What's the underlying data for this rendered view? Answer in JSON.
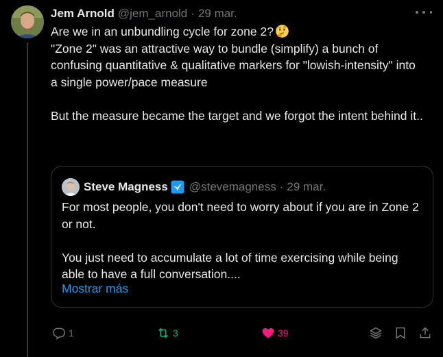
{
  "tweet": {
    "author_name": "Jem Arnold",
    "author_handle": "@jem_arnold",
    "separator": "·",
    "date": "29 mar.",
    "text_line1": "Are we in an unbundling cycle for zone 2?",
    "text_rest": "\n\"Zone 2\" was an attractive way to bundle (simplify) a bunch of confusing quantitative & qualitative markers for \"lowish-intensity\" into a single power/pace measure\n\nBut the measure became the target and we forgot the intent behind it..",
    "emoji": "thinking-face-emoji"
  },
  "quote": {
    "author_name": "Steve Magness",
    "author_handle": "@stevemagness",
    "separator": "·",
    "date": "29 mar.",
    "verified": true,
    "text": "For most people, you don't need to worry about if you are in Zone 2 or not.\n\nYou just need to accumulate a lot of time exercising while being able to have a full conversation....",
    "show_more": "Mostrar más"
  },
  "actions": {
    "replies": "1",
    "retweets": "3",
    "likes": "39"
  },
  "colors": {
    "background": "#000000",
    "text": "#e7e9ea",
    "muted": "#71767b",
    "link": "#1d9bf0",
    "retweet": "#00ba7c",
    "like": "#f91880",
    "border": "#2f3336"
  }
}
